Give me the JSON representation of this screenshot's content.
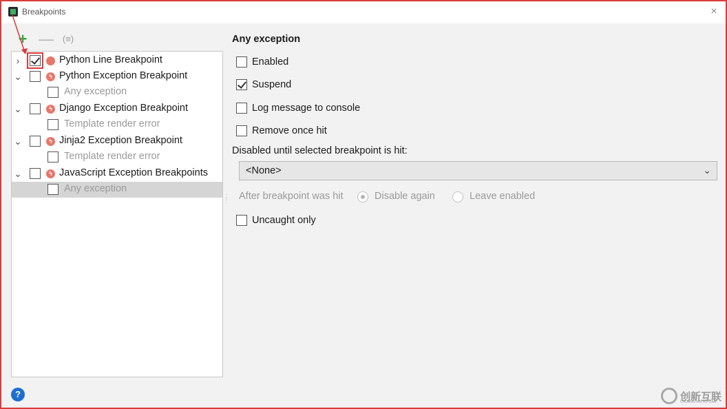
{
  "window": {
    "title": "Breakpoints",
    "close_glyph": "×"
  },
  "toolbar": {
    "add_glyph": "+",
    "remove_glyph": "—",
    "group_glyph": "(≡)"
  },
  "tree": {
    "items": [
      {
        "label": "Python Line Breakpoint",
        "checked": true,
        "expanded": false,
        "indent": 0,
        "icon": "breakpoint-dot-icon"
      },
      {
        "label": "Python Exception Breakpoint",
        "checked": false,
        "expanded": true,
        "indent": 0,
        "icon": "exception-breakpoint-icon"
      },
      {
        "label": "Any exception",
        "checked": false,
        "indent": 1
      },
      {
        "label": "Django Exception Breakpoint",
        "checked": false,
        "expanded": true,
        "indent": 0,
        "icon": "exception-breakpoint-icon"
      },
      {
        "label": "Template render error",
        "checked": false,
        "indent": 1
      },
      {
        "label": "Jinja2 Exception Breakpoint",
        "checked": false,
        "expanded": true,
        "indent": 0,
        "icon": "exception-breakpoint-icon"
      },
      {
        "label": "Template render error",
        "checked": false,
        "indent": 1
      },
      {
        "label": "JavaScript Exception Breakpoints",
        "checked": false,
        "expanded": true,
        "indent": 0,
        "icon": "exception-breakpoint-icon"
      },
      {
        "label": "Any exception",
        "checked": false,
        "indent": 1,
        "selected": true
      }
    ]
  },
  "detail": {
    "title": "Any exception",
    "options": {
      "enabled": {
        "label": "Enabled",
        "checked": false
      },
      "suspend": {
        "label": "Suspend",
        "checked": true
      },
      "log_message": {
        "label": "Log message to console",
        "checked": false
      },
      "remove_once_hit": {
        "label": "Remove once hit",
        "checked": false
      },
      "uncaught_only": {
        "label": "Uncaught only",
        "checked": false
      }
    },
    "disabled_until_label": "Disabled until selected breakpoint is hit:",
    "disabled_until_value": "<None>",
    "after_hit_label": "After breakpoint was hit",
    "after_hit_options": {
      "disable_again": "Disable again",
      "leave_enabled": "Leave enabled"
    },
    "after_hit_selected": "disable_again"
  },
  "help": {
    "glyph": "?"
  },
  "watermark": {
    "text": "创新互联",
    "sub": "CHUANG XIN HU LIAN"
  },
  "colors": {
    "annotation_red": "#d93a3a",
    "add_green": "#3aa54a",
    "breakpoint_red": "#e8766a",
    "help_blue": "#1c6fd1"
  }
}
